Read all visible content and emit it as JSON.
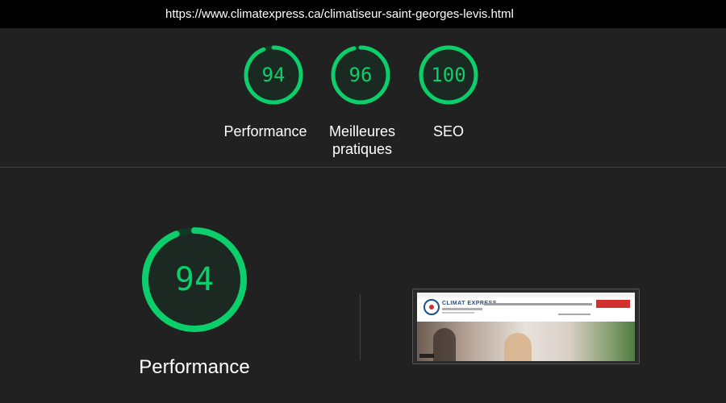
{
  "url": "https://www.climatexpress.ca/climatiseur-saint-georges-levis.html",
  "colors": {
    "pass": "#0cce6b",
    "pass_bg": "#0f3a23",
    "background": "#212121"
  },
  "summary_gauges": [
    {
      "score": "94",
      "label": "Performance",
      "value": 0.94
    },
    {
      "score": "96",
      "label": "Meilleures pratiques",
      "value": 0.96
    },
    {
      "score": "100",
      "label": "SEO",
      "value": 1.0
    }
  ],
  "main_gauge": {
    "score": "94",
    "label": "Performance",
    "value": 0.94
  },
  "screenshot": {
    "brand": "CLIMAT EXPRESS"
  }
}
